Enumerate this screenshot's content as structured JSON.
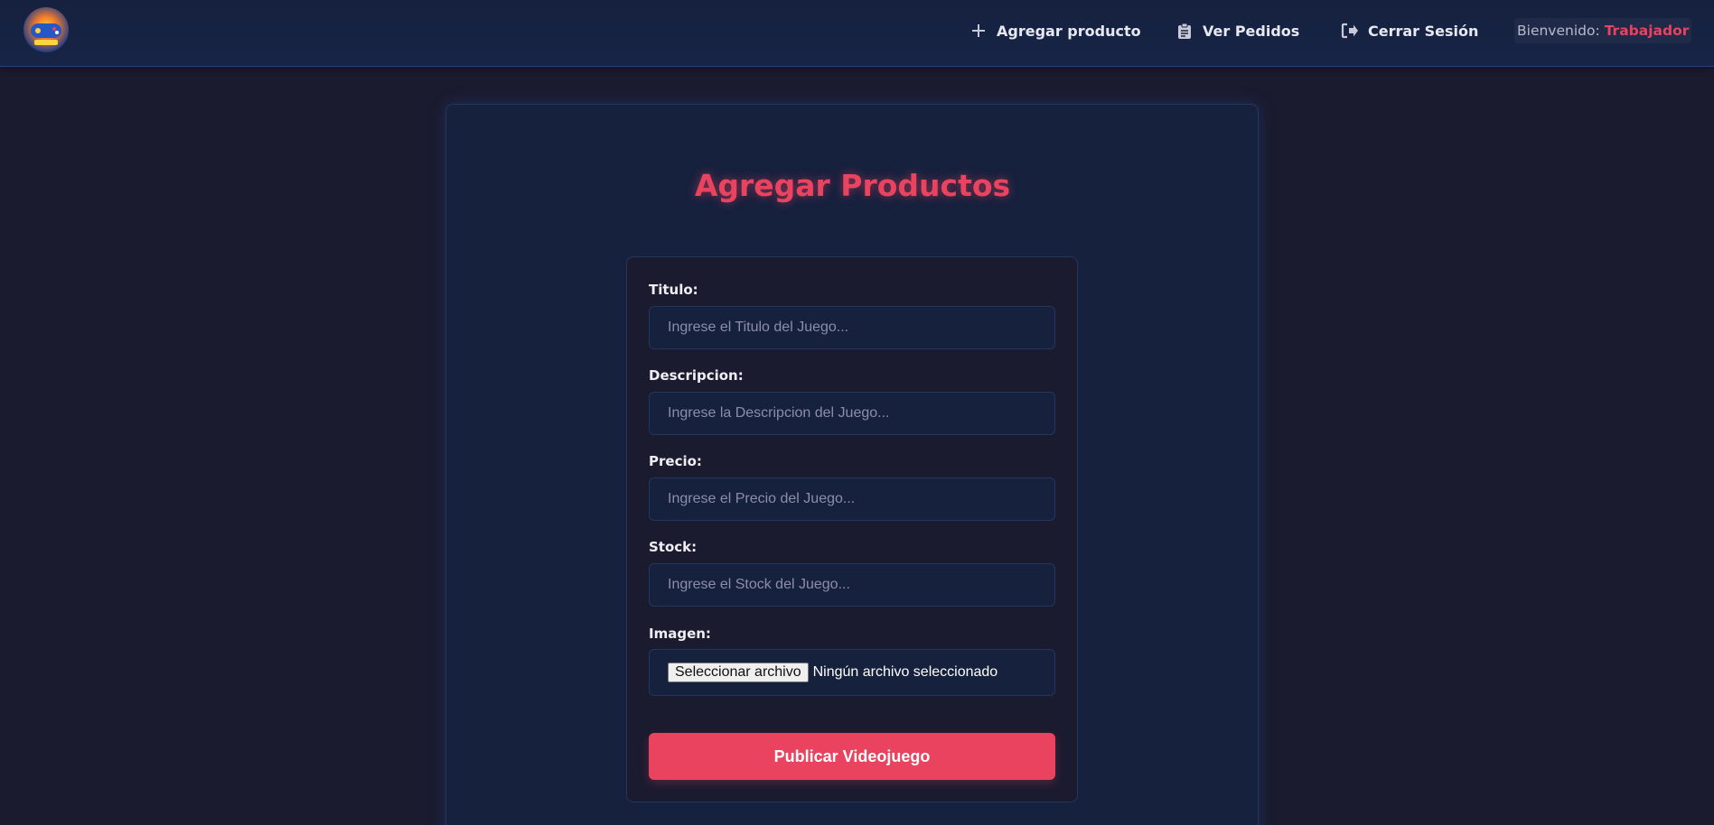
{
  "header": {
    "logo_icon": "gamepad-logo-icon",
    "nav": [
      {
        "icon": "plus-icon",
        "label": "Agregar producto"
      },
      {
        "icon": "clipboard-icon",
        "label": "Ver Pedidos"
      },
      {
        "icon": "sign-out-icon",
        "label": "Cerrar Sesión"
      }
    ],
    "welcome_label": "Bienvenido:",
    "user_name": "Trabajador"
  },
  "form": {
    "title": "Agregar Productos",
    "fields": [
      {
        "label": "Titulo:",
        "placeholder": "Ingrese el Titulo del Juego...",
        "value": ""
      },
      {
        "label": "Descripcion:",
        "placeholder": "Ingrese la Descripcion del Juego...",
        "value": ""
      },
      {
        "label": "Precio:",
        "placeholder": "Ingrese el Precio del Juego...",
        "value": ""
      },
      {
        "label": "Stock:",
        "placeholder": "Ingrese el Stock del Juego...",
        "value": ""
      }
    ],
    "image_label": "Imagen:",
    "file_button": "Seleccionar archivo",
    "file_status": "Ningún archivo seleccionado",
    "submit_label": "Publicar Videojuego"
  },
  "colors": {
    "background": "#1b1b2f",
    "panel": "#16213e",
    "accent": "#e9435f"
  }
}
